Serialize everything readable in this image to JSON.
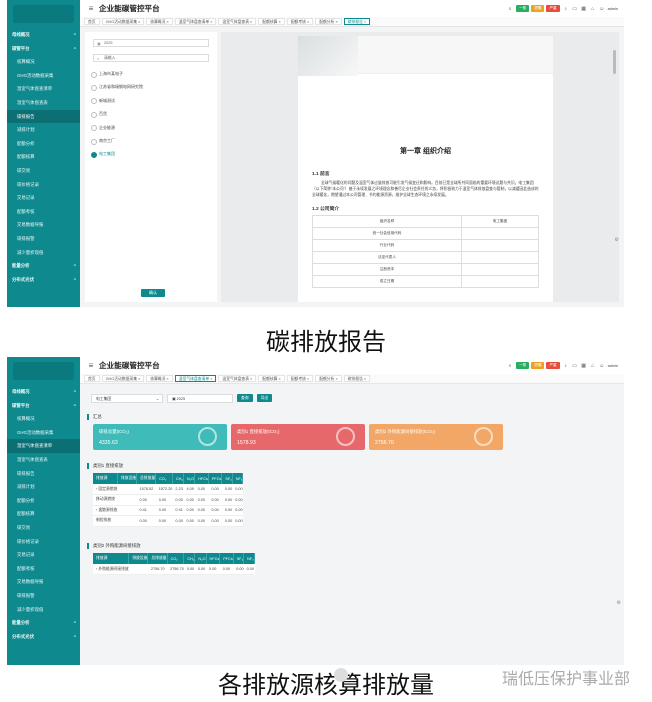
{
  "app": {
    "title": "企业能碳管控平台",
    "user": "admin",
    "badges": [
      {
        "label": "一般",
        "color": "#27ae60"
      },
      {
        "label": "提醒",
        "color": "#f0a020"
      },
      {
        "label": "严重",
        "color": "#e74c3c"
      }
    ]
  },
  "sidebar": {
    "items": [
      {
        "label": "母线概况",
        "type": "group"
      },
      {
        "label": "碳管平台",
        "type": "group"
      },
      {
        "label": "核算概况",
        "type": "item"
      },
      {
        "label": "GHG活动数据采集",
        "type": "item"
      },
      {
        "label": "温室气体盘查清单",
        "type": "item"
      },
      {
        "label": "温室气体盘查表",
        "type": "item"
      },
      {
        "label": "碳排报告",
        "type": "item"
      },
      {
        "label": "减排计划",
        "type": "item"
      },
      {
        "label": "配额分析",
        "type": "item"
      },
      {
        "label": "配额核算",
        "type": "item"
      },
      {
        "label": "碳交易",
        "type": "item"
      },
      {
        "label": "碳价格记录",
        "type": "item"
      },
      {
        "label": "交易记录",
        "type": "item"
      },
      {
        "label": "配额考核",
        "type": "item"
      },
      {
        "label": "交易数据导报",
        "type": "item"
      },
      {
        "label": "碳排报警",
        "type": "item"
      },
      {
        "label": "减少量折现值",
        "type": "item"
      },
      {
        "label": "能量分析",
        "type": "group"
      },
      {
        "label": "分布式光伏",
        "type": "group"
      }
    ]
  },
  "screen1": {
    "tabs": [
      "首页",
      "GHG活动数据采集",
      "核算概况",
      "温室气体盘查清单",
      "温室气体盘查表",
      "配额核算",
      "配额考核",
      "配额分析",
      "碳排报告"
    ],
    "active_tab": 8,
    "active_sidebar": 6,
    "year": "2025",
    "search_placeholder": "请输入",
    "orgs": [
      "上海市某电子",
      "江苏省和瑞钢电网研究院",
      "新城测试",
      "百货",
      "企业能源",
      "南京工厂",
      "电工集团"
    ],
    "selected_org": 6,
    "confirm_label": "确认",
    "report": {
      "chapter_title": "第一章 组织介绍",
      "sec1": "1.1 前言",
      "para": "全球气候暖化的问题及温室气体过量排放可能引发气候变迁和影响。目前已是全球所共同面临的重要环境议题与共识。电工集团（以下简称“本公司”）基于永续发展之环境理念和善尽企业社会责任的义务，将积极致力于温室气体排放盘查与管制，以减缓因此造成的全球暖化，期望通过本公司管理、节约能源资源，维护全球生态环境之永续发展。",
      "sec2": "1.2 公司简介",
      "table": [
        [
          "组织名称",
          "电工集团"
        ],
        [
          "统一社会信用代码",
          ""
        ],
        [
          "行业代码",
          ""
        ],
        [
          "法定代表人",
          ""
        ],
        [
          "注册资本",
          ""
        ],
        [
          "成立日期",
          ""
        ]
      ]
    },
    "caption": "碳排放报告"
  },
  "screen2": {
    "tabs": [
      "首页",
      "GHG活动数据采集",
      "核算概况",
      "温室气体盘查清单",
      "温室气体盘查表",
      "配额核算",
      "配额考核",
      "配额分析",
      "碳排报告"
    ],
    "active_tab": 3,
    "active_sidebar": 4,
    "org_select": "电工集团",
    "year": "2025",
    "query_label": "查询",
    "export_label": "导出",
    "summary_title": "汇总",
    "cards": [
      {
        "label": "碳排总量(tCO₂)",
        "value": "4335.63",
        "color": "#3fbcb9"
      },
      {
        "label": "类别1 直接排放(tCO₂)",
        "value": "1578.93",
        "color": "#e7686a"
      },
      {
        "label": "类别2 外购能源间接排放(tCO₂)",
        "value": "2756.70",
        "color": "#f2a766"
      }
    ],
    "sect1": "类别1 直接排放",
    "sect2": "类别2 外购能源间接排放",
    "columns": [
      "排放源",
      "排放设施",
      "总排放量",
      "CO₂",
      "CH₄",
      "N₂O",
      "HFCs",
      "PFCs",
      "SF₆",
      "NF₃"
    ],
    "rows1": [
      [
        "› 固定源燃烧",
        "",
        "1578.52",
        "1572.20",
        "2.23",
        "4.09",
        "0.00",
        "0.00",
        "0.00",
        "0.00"
      ],
      [
        "移动源燃烧",
        "",
        "0.00",
        "0.00",
        "0.00",
        "0.00",
        "0.00",
        "0.00",
        "0.00",
        "0.00"
      ],
      [
        "› 逸散源排放",
        "",
        "0.41",
        "0.00",
        "0.41",
        "0.00",
        "0.00",
        "0.00",
        "0.00",
        "0.00"
      ],
      [
        "制程排放",
        "",
        "0.00",
        "0.00",
        "0.00",
        "0.00",
        "0.00",
        "0.00",
        "0.00",
        "0.00"
      ]
    ],
    "rows2": [
      [
        "› 外购能源间接排放",
        "",
        "2756.70",
        "2756.70",
        "0.00",
        "0.00",
        "0.00",
        "0.00",
        "0.00",
        "0.00"
      ]
    ],
    "caption": "各排放源核算排放量"
  },
  "watermark": "瑞低压保护事业部"
}
